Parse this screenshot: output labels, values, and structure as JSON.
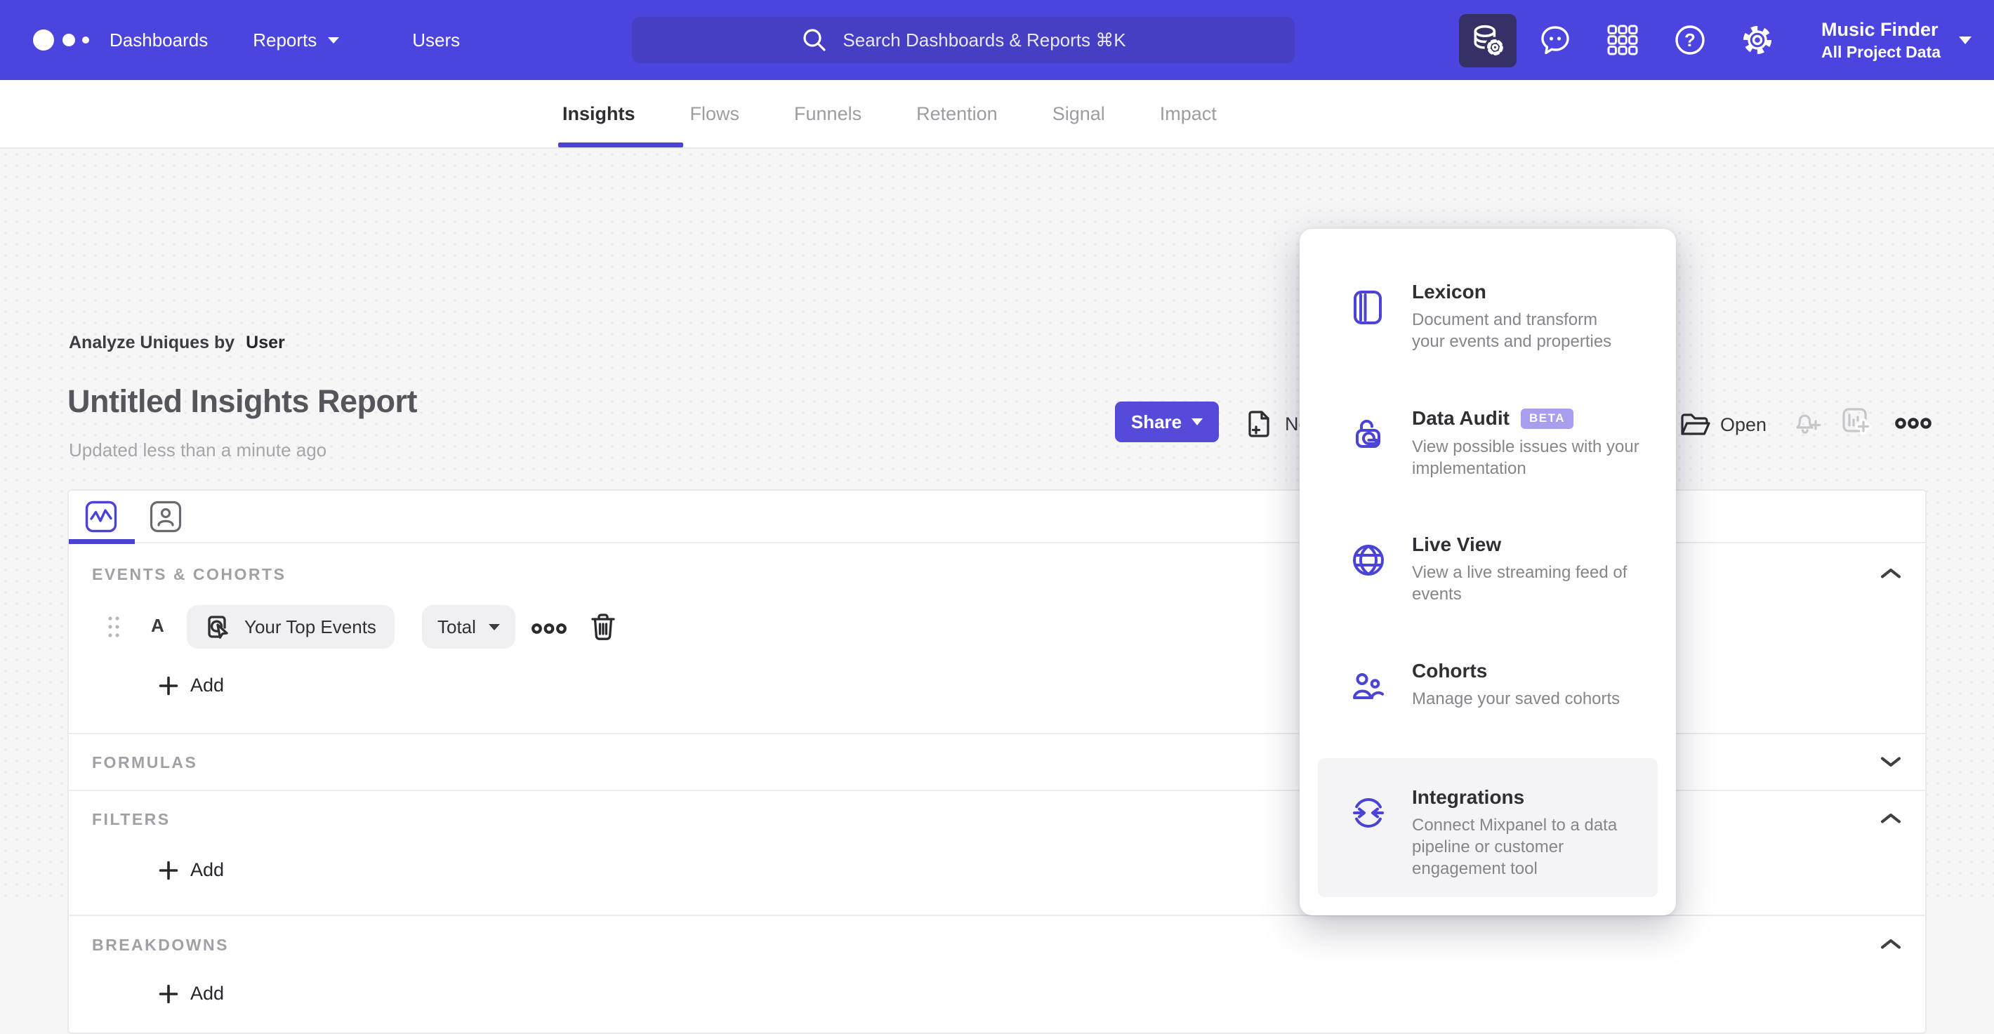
{
  "nav": {
    "links": [
      "Dashboards",
      "Reports",
      "Users"
    ],
    "search_placeholder": "Search Dashboards & Reports ⌘K",
    "project_name": "Music Finder",
    "project_scope": "All Project Data"
  },
  "tabs": [
    "Insights",
    "Flows",
    "Funnels",
    "Retention",
    "Signal",
    "Impact"
  ],
  "report": {
    "analyze_prefix": "Analyze Uniques by",
    "analyze_entity": "User",
    "title": "Untitled Insights Report",
    "updated": "Updated less than a minute ago",
    "share_label": "Share",
    "new_label": "New",
    "open_label": "Open"
  },
  "builder": {
    "events_label": "EVENTS & COHORTS",
    "formulas_label": "FORMULAS",
    "filters_label": "FILTERS",
    "breakdowns_label": "BREAKDOWNS",
    "series_letter": "A",
    "event_name": "Your Top Events",
    "metric": "Total",
    "add_label": "Add"
  },
  "menu": {
    "items": [
      {
        "title": "Lexicon",
        "badge": "",
        "desc": "Document and transform your events and properties",
        "icon": "lexicon-book-icon"
      },
      {
        "title": "Data Audit",
        "badge": "BETA",
        "desc": "View possible issues with your implementation",
        "icon": "data-audit-lock-icon"
      },
      {
        "title": "Live View",
        "badge": "",
        "desc": "View a live streaming feed of events",
        "icon": "live-view-globe-icon"
      },
      {
        "title": "Cohorts",
        "badge": "",
        "desc": "Manage your saved cohorts",
        "icon": "cohorts-people-icon"
      },
      {
        "title": "Integrations",
        "badge": "",
        "desc": "Connect Mixpanel to a data pipeline or customer engagement tool",
        "icon": "integrations-sync-icon"
      }
    ]
  },
  "colors": {
    "navbar": "#4c44df",
    "search_bg": "#463fc3",
    "active_nav_button_bg": "#353066",
    "accent": "#4b42d6",
    "share_button": "#564adb",
    "beta_badge": "#a89ef0",
    "menu_highlight": "#f4f4f6",
    "page_bg": "#f6f6f7"
  }
}
